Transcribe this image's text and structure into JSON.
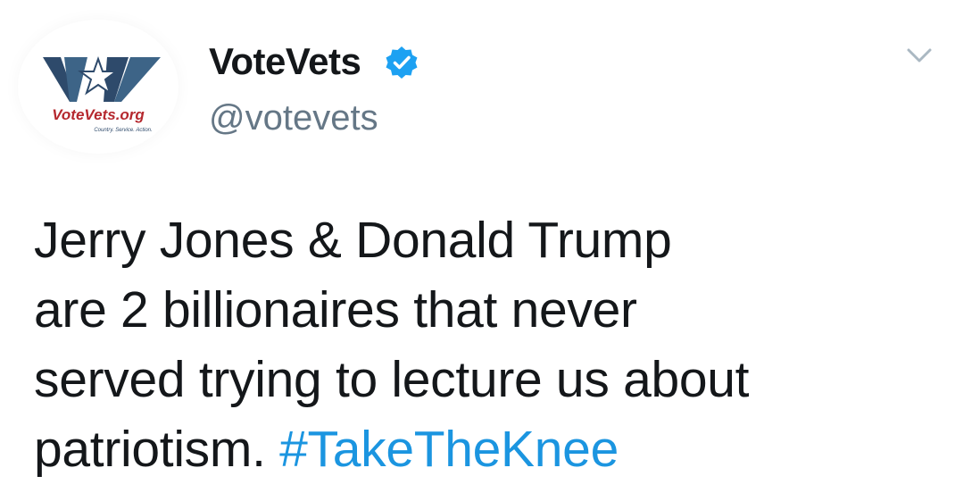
{
  "tweet": {
    "author": {
      "avatar_name": "VoteVets.org",
      "avatar_tagline": "Country. Service. Action.",
      "display_name": "VoteVets",
      "handle": "@votevets",
      "verified": true,
      "icon": "verified-badge-icon"
    },
    "menu_icon": "chevron-down-icon",
    "text_lines": [
      "Jerry Jones & Donald Trump",
      "are 2 billionaires that never",
      "served trying to lecture us about",
      "patriotism. "
    ],
    "hashtag": "#TakeTheKnee"
  },
  "colors": {
    "text": "#14171a",
    "handle": "#657786",
    "link": "#1b95e0",
    "verified": "#1da1f2",
    "logo_blue": "#2e4a6b",
    "logo_red": "#b5282e"
  }
}
